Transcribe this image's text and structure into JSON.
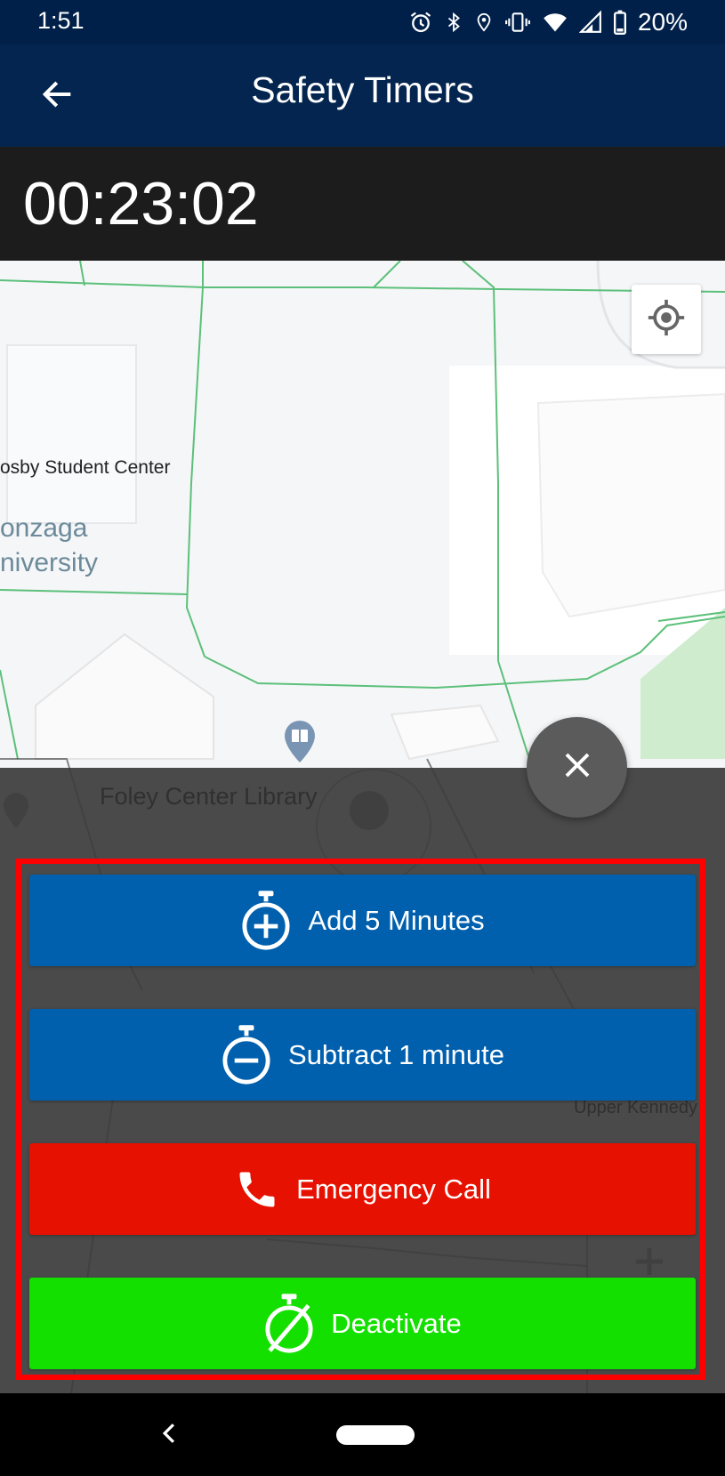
{
  "status_bar": {
    "time": "1:51",
    "battery_percent": "20%",
    "icons": [
      "alarm-icon",
      "bluetooth-icon",
      "location-icon",
      "vibrate-icon",
      "wifi-icon",
      "signal-icon",
      "battery-icon"
    ]
  },
  "app_bar": {
    "title": "Safety Timers",
    "back_icon": "arrow-left-icon"
  },
  "timer": {
    "value": "00:23:02"
  },
  "map": {
    "labels": {
      "student_center": "osby Student Center",
      "university_line1": "onzaga",
      "university_line2": "niversity",
      "library": "Foley Center Library",
      "kennedy": "Upper Kennedy"
    },
    "locate_icon": "my-location-icon",
    "colors": {
      "paths": "#5cc07a",
      "overlay": "#3c3c3c"
    }
  },
  "actions": {
    "close_icon": "close-icon",
    "add": {
      "label": "Add 5 Minutes",
      "icon": "stopwatch-plus-icon",
      "color": "#0060ae"
    },
    "subtract": {
      "label": "Subtract 1 minute",
      "icon": "stopwatch-minus-icon",
      "color": "#0060ae"
    },
    "emergency": {
      "label": "Emergency Call",
      "icon": "phone-icon",
      "color": "#e61100"
    },
    "deactivate": {
      "label": "Deactivate",
      "icon": "timer-off-icon",
      "color": "#14e000"
    }
  },
  "nav_bar": {
    "back_icon": "chevron-left-icon",
    "home_icon": "home-pill-icon"
  }
}
